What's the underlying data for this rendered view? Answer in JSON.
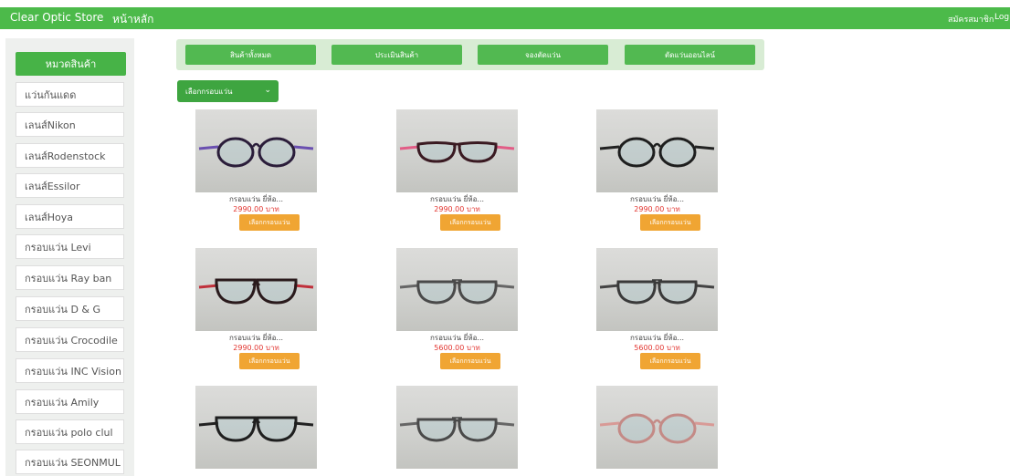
{
  "nav": {
    "brand": "Clear Optic Store",
    "home": "หน้าหลัก",
    "register": "สมัครสมาชิก",
    "login": "Login"
  },
  "sidebar": {
    "header": "หมวดสินค้า",
    "items": [
      "แว่นกันแดด",
      "เลนส์Nikon",
      "เลนส์Rodenstock",
      "เลนส์Essilor",
      "เลนส์Hoya",
      "กรอบแว่น Levi",
      "กรอบแว่น Ray ban",
      "กรอบแว่น D & G",
      "กรอบแว่น Crocodile",
      "กรอบแว่น INC Vision",
      "กรอบแว่น Amily",
      "กรอบแว่น polo clul",
      "กรอบแว่น SEONMUL"
    ]
  },
  "tabs": [
    "สินค้าทั้งหมด",
    "ประเมินสินค้า",
    "จองตัดแว่น",
    "ตัดแว่นออนไลน์"
  ],
  "filter": {
    "selected": "เลือกกรอบแว่น"
  },
  "colors": {
    "brand_green": "#4cba4a",
    "button_orange": "#f0a533",
    "price_red": "#e2342f"
  },
  "products": [
    {
      "name": "กรอบแว่น ยี่ห้อ...",
      "price": "2990.00 บาท",
      "button": "เลือกกรอบแว่น",
      "frame": "round-purple"
    },
    {
      "name": "กรอบแว่น ยี่ห้อ...",
      "price": "2990.00 บาท",
      "button": "เลือกกรอบแว่น",
      "frame": "oval-pink"
    },
    {
      "name": "กรอบแว่น ยี่ห้อ...",
      "price": "2990.00 บาท",
      "button": "เลือกกรอบแว่น",
      "frame": "round-black"
    },
    {
      "name": "กรอบแว่น ยี่ห้อ...",
      "price": "2990.00 บาท",
      "button": "เลือกกรอบแว่น",
      "frame": "square-red"
    },
    {
      "name": "กรอบแว่น ยี่ห้อ...",
      "price": "5600.00 บาท",
      "button": "เลือกกรอบแว่น",
      "frame": "aviator-silver"
    },
    {
      "name": "กรอบแว่น ยี่ห้อ...",
      "price": "5600.00 บาท",
      "button": "เลือกกรอบแว่น",
      "frame": "aviator-dark"
    },
    {
      "name": "",
      "price": "",
      "button": "",
      "frame": "square-black"
    },
    {
      "name": "",
      "price": "",
      "button": "",
      "frame": "aviator-silver"
    },
    {
      "name": "",
      "price": "",
      "button": "",
      "frame": "round-rose"
    }
  ]
}
